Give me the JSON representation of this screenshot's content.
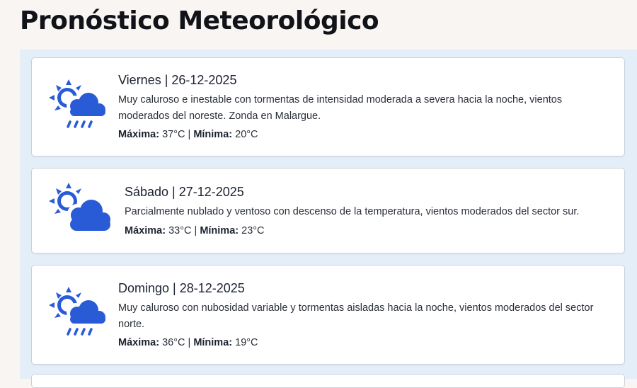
{
  "header": {
    "title": "Pronóstico Meteorológico"
  },
  "colors": {
    "icon_blue": "#2a5bd7",
    "panel_bg": "#e3eef9",
    "page_bg": "#f8f5f2"
  },
  "forecasts": [
    {
      "title": "Viernes | 26-12-2025",
      "description": "Muy caluroso e inestable con tormentas de intensidad moderada a severa hacia la noche, vientos moderados del noreste. Zonda en Malargue.",
      "max_label": "Máxima:",
      "max_value": "37°C",
      "separator": "|",
      "min_label": "Mínima:",
      "min_value": "20°C",
      "icon": "sun-cloud-rain-icon"
    },
    {
      "title": "Sábado | 27-12-2025",
      "description": "Parcialmente nublado y ventoso con descenso de la temperatura, vientos moderados del sector sur.",
      "max_label": "Máxima:",
      "max_value": "33°C",
      "separator": "|",
      "min_label": "Mínima:",
      "min_value": "23°C",
      "icon": "sun-cloud-icon"
    },
    {
      "title": "Domingo | 28-12-2025",
      "description": "Muy caluroso con nubosidad variable y tormentas aisladas hacia la noche, vientos moderados del sector norte.",
      "max_label": "Máxima:",
      "max_value": "36°C",
      "separator": "|",
      "min_label": "Mínima:",
      "min_value": "19°C",
      "icon": "sun-cloud-rain-icon"
    }
  ]
}
